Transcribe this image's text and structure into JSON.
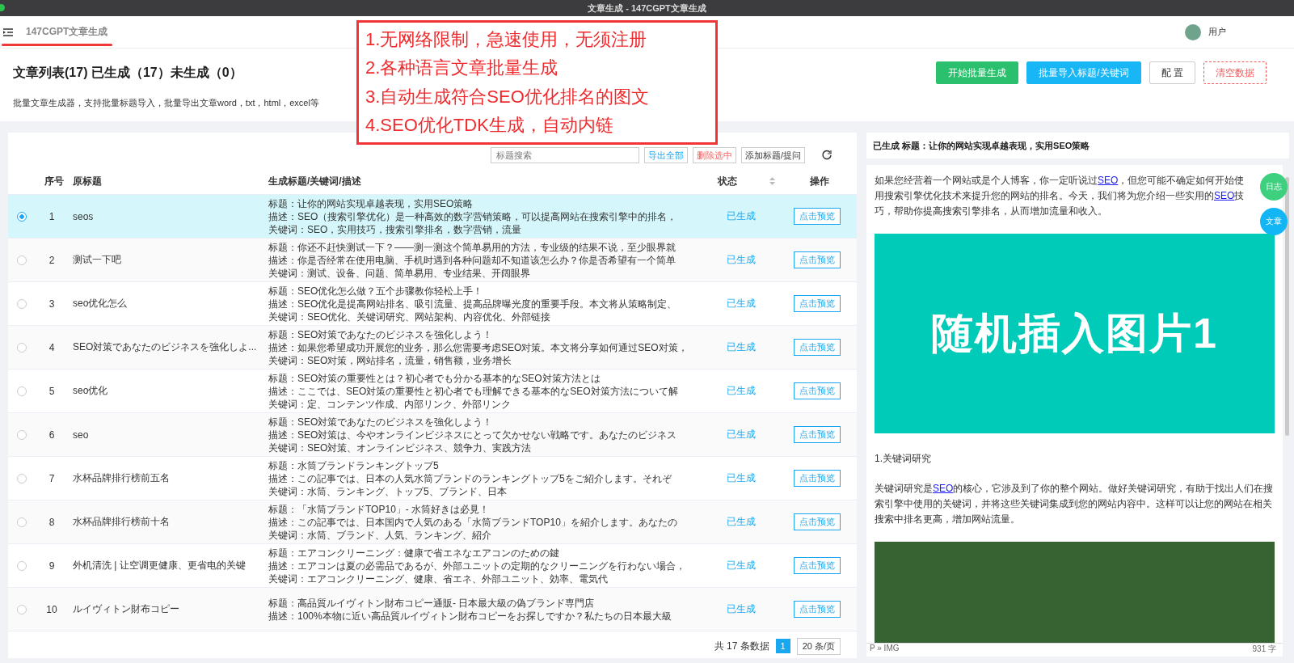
{
  "window": {
    "title": "文章生成 - 147CGPT文章生成"
  },
  "topbar": {
    "app_name": "147CGPT文章生成",
    "user": "用户"
  },
  "header": {
    "title": "文章列表(17) 已生成（17）未生成（0）",
    "description": "批量文章生成器，支持批量标题导入，批量导出文章word，txt，html，excel等",
    "buttons": [
      {
        "label": "开始批量生成",
        "kind": "success"
      },
      {
        "label": "批量导入标题/关键词",
        "kind": "primary"
      },
      {
        "label": "配 置",
        "kind": "default"
      },
      {
        "label": "清空数据",
        "kind": "danger"
      }
    ]
  },
  "annotation": {
    "lines": [
      "1.无网络限制，急速使用，无须注册",
      "2.各种语言文章批量生成",
      "3.自动生成符合SEO优化排名的图文",
      "4.SEO优化TDK生成，自动内链"
    ]
  },
  "toolbar": {
    "search_placeholder": "标题搜索",
    "buttons": [
      {
        "label": "导出全部",
        "kind": "primary"
      },
      {
        "label": "删除选中",
        "kind": "danger"
      },
      {
        "label": "添加标题/提问",
        "kind": "default"
      }
    ]
  },
  "table": {
    "columns": [
      "序号",
      "原标题",
      "生成标题/关键词/描述",
      "状态",
      "操作"
    ],
    "rows": [
      {
        "selected": true,
        "index": "1",
        "original": "seos",
        "generated": [
          "标题：让你的网站实现卓越表现，实用SEO策略",
          "描述：SEO（搜索引擎优化）是一种高效的数字营销策略，可以提高网站在搜索引擎中的排名，",
          "关键词：SEO，实用技巧，搜索引擎排名，数字营销，流量"
        ],
        "status": "已生成",
        "action": "点击预览"
      },
      {
        "selected": false,
        "index": "2",
        "original": "测试一下吧",
        "generated": [
          "标题：你还不赶快测试一下？——测一测这个简单易用的方法，专业级的结果不说，至少眼界就",
          "描述：你是否经常在使用电脑、手机时遇到各种问题却不知道该怎么办？你是否希望有一个简单",
          "关键词：测试、设备、问题、简单易用、专业结果、开阔眼界"
        ],
        "status": "已生成",
        "action": "点击预览"
      },
      {
        "selected": false,
        "index": "3",
        "original": "seo优化怎么",
        "generated": [
          "标题：SEO优化怎么做？五个步骤教你轻松上手！",
          "描述：SEO优化是提高网站排名、吸引流量、提高品牌曝光度的重要手段。本文将从策略制定、",
          "关键词：SEO优化、关键词研究、网站架构、内容优化、外部链接"
        ],
        "status": "已生成",
        "action": "点击预览"
      },
      {
        "selected": false,
        "index": "4",
        "original": "SEO対策であなたのビジネスを強化しよ...",
        "generated": [
          "标题：SEO対策であなたのビジネスを強化しよう！",
          "描述：如果您希望成功开展您的业务，那么您需要考虑SEO对策。本文将分享如何通过SEO对策，",
          "关键词：SEO对策，网站排名，流量，销售额，业务增长"
        ],
        "status": "已生成",
        "action": "点击预览"
      },
      {
        "selected": false,
        "index": "5",
        "original": "seo优化",
        "generated": [
          "标题：SEO対策の重要性とは？初心者でも分かる基本的なSEO対策方法とは",
          "描述：ここでは、SEO対策の重要性と初心者でも理解できる基本的なSEO対策方法について解",
          "关键词：定、コンテンツ作成、内部リンク、外部リンク"
        ],
        "status": "已生成",
        "action": "点击预览"
      },
      {
        "selected": false,
        "index": "6",
        "original": "seo",
        "generated": [
          "标题：SEO対策であなたのビジネスを強化しよう！",
          "描述：SEO対策は、今やオンラインビジネスにとって欠かせない戦略です。あなたのビジネス",
          "关键词：SEO対策、オンラインビジネス、競争力、実践方法"
        ],
        "status": "已生成",
        "action": "点击预览"
      },
      {
        "selected": false,
        "index": "7",
        "original": "水杯品牌排行榜前五名",
        "generated": [
          "标题：水筒ブランドランキングトップ5",
          "描述：この記事では、日本の人気水筒ブランドのランキングトップ5をご紹介します。それぞ",
          "关键词：水筒、ランキング、トップ5、ブランド、日本"
        ],
        "status": "已生成",
        "action": "点击预览"
      },
      {
        "selected": false,
        "index": "8",
        "original": "水杯品牌排行榜前十名",
        "generated": [
          "标题：「水筒ブランドTOP10」- 水筒好きは必見！",
          "描述：この記事では、日本国内で人気のある「水筒ブランドTOP10」を紹介します。あなたの",
          "关键词：水筒、ブランド、人気、ランキング、紹介"
        ],
        "status": "已生成",
        "action": "点击预览"
      },
      {
        "selected": false,
        "index": "9",
        "original": "外机清洗 | 让空调更健康、更省电的关键",
        "generated": [
          "标题：エアコンクリーニング：健康で省エネなエアコンのための鍵",
          "描述：エアコンは夏の必需品であるが、外部ユニットの定期的なクリーニングを行わない場合，",
          "关键词：エアコンクリーニング、健康、省エネ、外部ユニット、効率、電気代"
        ],
        "status": "已生成",
        "action": "点击预览"
      },
      {
        "selected": false,
        "index": "10",
        "original": "ルイヴィトン財布コピー",
        "generated": [
          "标题：高品質ルイヴィトン財布コピー通販- 日本最大級の偽ブランド専門店",
          "描述：100%本物に近い高品質ルイヴィトン財布コピーをお探しですか？私たちの日本最大級"
        ],
        "status": "已生成",
        "action": "点击预览"
      }
    ]
  },
  "pagination": {
    "total": "共 17 条数据",
    "page": "1",
    "page_size": "20 条/页"
  },
  "preview": {
    "title": "已生成 标题：让你的网站实现卓越表现，实用SEO策略",
    "blocks": [
      {
        "kind": "paragraph",
        "segments": [
          {
            "text": "如果您经营着一个网站或是个人博客，你一定听说过"
          },
          {
            "text": "SEO",
            "link": true
          },
          {
            "text": "，但您可能不确定如何开始使用搜索引擎优化技术来提升您的网站的排名。今天，我们将为您介绍一些实用的"
          },
          {
            "text": "SEO",
            "link": true
          },
          {
            "text": "技巧，帮助你提高搜索引擎排名，从而增加流量和收入。"
          }
        ]
      },
      {
        "kind": "image",
        "color": "#00cbb8",
        "caption": "随机插入图片1"
      },
      {
        "kind": "paragraph",
        "segments": [
          {
            "text": "1.关键词研究"
          }
        ]
      },
      {
        "kind": "paragraph",
        "segments": [
          {
            "text": "关键词研究是"
          },
          {
            "text": "SEO",
            "link": true
          },
          {
            "text": "的核心，它涉及到了你的整个网站。做好关键词研究，有助于找出人们在搜索引擎中使用的关键词，并将这些关键词集成到您的网站内容中。这样可以让您的网站在相关搜索中排名更高，增加网站流量。"
          }
        ]
      },
      {
        "kind": "image",
        "color": "#366331"
      }
    ],
    "path": "P » IMG",
    "word_count": "931 字",
    "floating_buttons": [
      {
        "label": "日志",
        "color": "#3ecf7f"
      },
      {
        "label": "文章",
        "color": "#12b6f5"
      }
    ]
  }
}
